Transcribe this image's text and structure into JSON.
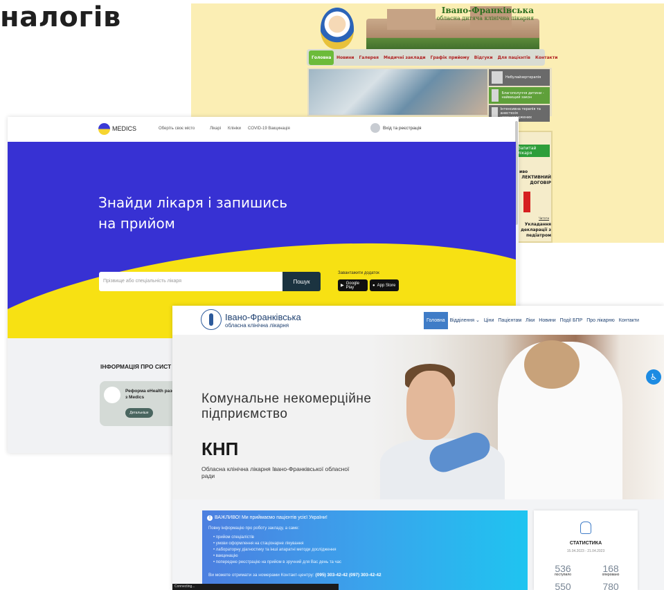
{
  "heading": "налогів",
  "hospital_children": {
    "title": "Івано-Франківська",
    "subtitle": "обласна дитяча клінічна лікарня",
    "nav": [
      "Головна",
      "Новини",
      "Галерея",
      "Медичні заклади",
      "Графік прийому",
      "Відгуки",
      "Для пацієнтів",
      "Контакти"
    ],
    "news": [
      "Небулайзертерапія",
      "Благополуччя дитини - найвищий закон",
      "Інтенсивна терапія та анестезія новонароджених"
    ],
    "side_button": "Запитай лікаря",
    "side_label": "иво",
    "side_contract": "ЛЕКТИВНИЙ ДОГОВІР",
    "side_small": "Читати",
    "side_declaration": "Укладання декларації з педіатром"
  },
  "medics": {
    "logo": "MEDICS",
    "city": "Оберіть своє місто",
    "links": [
      "Лікарі",
      "Клініки",
      "COVID-19 Вакцинація"
    ],
    "login": "Вхід та реєстрація",
    "hero_title": "Знайди лікаря і запишись на прийом",
    "search_placeholder": "Прізвище або спеціальність лікаря",
    "search_button": "Пошук",
    "download": "Завантажити додаток",
    "google_play": "Google Play",
    "app_store": "App Store",
    "info_title": "ІНФОРМАЦІЯ ПРО СИСТ",
    "card_text": "Реформа eHealth разом з Medics",
    "card_button": "Детальніше"
  },
  "hospital_clinical": {
    "title": "Івано-Франківська",
    "subtitle": "обласна клінічна лікарня",
    "nav": [
      "Головна",
      "Відділення ⌄",
      "Ціни",
      "Пацієнтам",
      "Ліки",
      "Новини",
      "Події БПР",
      "Про лікарню",
      "Контакти"
    ],
    "hero_title": "Комунальне некомерційне підприємство",
    "knp": "КНП",
    "hero_sub": "Обласна клінічна лікарня Івано-Франківської обласної ради",
    "notice_title": "ВАЖЛИВО! Ми приймаємо пацієнтів усієї України!",
    "notice_intro": "Повну інформацію про роботу закладу, а саме:",
    "notice_items": [
      "прийом спеціалістів",
      "умови оформлення на стаціонарне лікування",
      "лабораторну діагностику та інші апаратні методи дослідження",
      "вакцинацію",
      "попередню реєстрацію на прийом в зручний для Вас день та час"
    ],
    "notice_phone_prefix": "Ви можете отримати за номерами Контакт-центру:",
    "notice_phones": "(095) 303-42-42  (097) 303-42-42",
    "stats_title": "СТАТИСТИКА",
    "stats_date": "15.04.2023 - 21.04.2023",
    "stats": [
      {
        "value": "536",
        "label": "поступило"
      },
      {
        "value": "168",
        "label": "оперовано"
      },
      {
        "value": "550",
        "label": ""
      },
      {
        "value": "780",
        "label": ""
      }
    ],
    "status": "Connecting..."
  }
}
